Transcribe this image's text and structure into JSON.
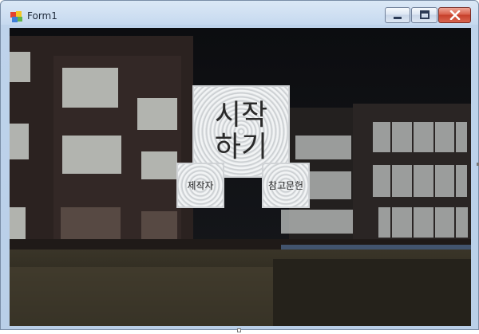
{
  "window": {
    "title": "Form1",
    "icon": "form-app-icon",
    "controls": {
      "minimize_icon": "minimize-icon",
      "maximize_icon": "maximize-icon",
      "close_icon": "close-icon"
    }
  },
  "menu": {
    "start_line1": "시작",
    "start_line2": "하기",
    "maker": "제작자",
    "references": "참고문헌"
  },
  "colors": {
    "title_bar": "#c6d9ef",
    "close_button": "#c7402b",
    "background": "#131519"
  }
}
